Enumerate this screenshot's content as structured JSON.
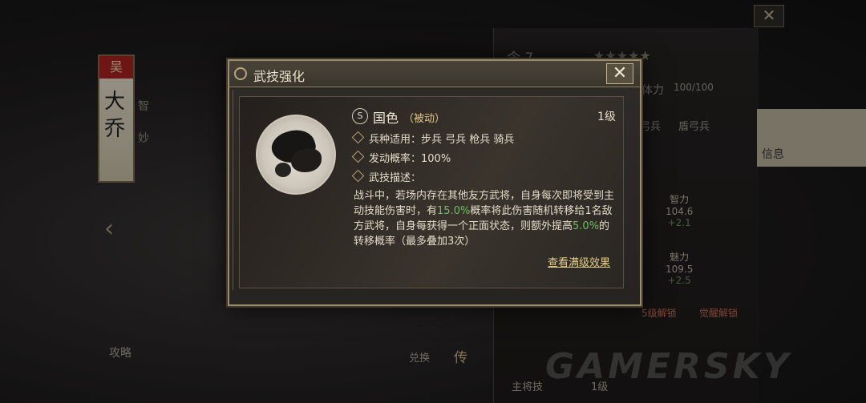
{
  "background": {
    "banner_faction": "吴",
    "banner_name": "大乔",
    "side_labels": [
      "智",
      "妙"
    ],
    "stat_label": "体力",
    "stat_value": "100/100",
    "unit_tags": [
      "弓兵",
      "盾弓兵"
    ],
    "info_label": "信息",
    "stats": [
      {
        "name": "智力",
        "value": "104.6",
        "add": "+2.1"
      },
      {
        "name": "魅力",
        "value": "109.5",
        "add": "+2.5"
      }
    ],
    "unlock_labels": [
      "5级解锁",
      "觉醒解锁"
    ],
    "strategy_label": "攻略",
    "exchange_label": "兑换",
    "pass_label": "传",
    "main_skill_label": "主将技",
    "level_label": "1级",
    "command_label": "令 7",
    "watermark": "GAMERSKY"
  },
  "modal": {
    "title": "武技强化",
    "close_symbol": "✕",
    "skill": {
      "badge": "S",
      "name": "国色",
      "type": "（被动）",
      "level": "1级",
      "troops": "兵种适用：步兵 弓兵 枪兵 骑兵",
      "rate": "发动概率：100%",
      "desc_label": "武技描述：",
      "desc_part1": "战斗中，若场内存在其他友方武将，自身每次即将受到主动技能伤害时，有",
      "desc_hl1": "15.0%",
      "desc_part2": "概率将此伤害随机转移给1名敌方武将，自身每获得一个正面状态，则额外提高",
      "desc_hl2": "5.0%",
      "desc_part3": "的转移概率（最多叠加3次）",
      "view_full": "查看满级效果"
    }
  },
  "colors": {
    "highlight": "#6fbd63",
    "gold": "#e3cf8c",
    "frame": "#9a8d6d"
  }
}
